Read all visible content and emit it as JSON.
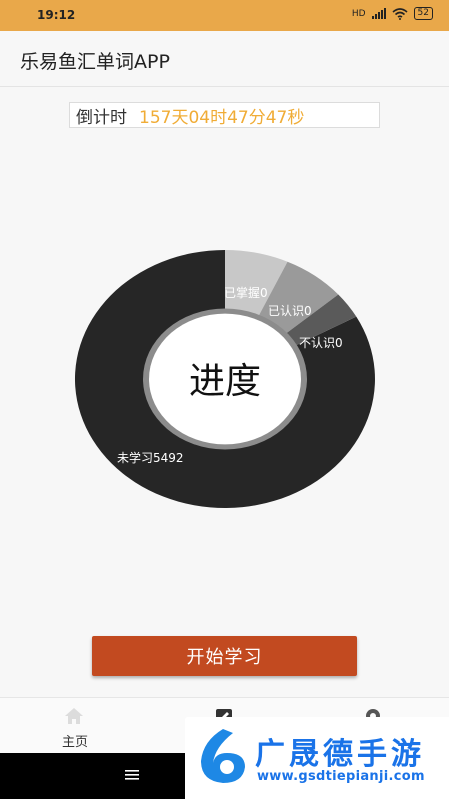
{
  "status": {
    "time": "19:12",
    "battery": "52",
    "hd_label": "HD"
  },
  "app": {
    "title": "乐易鱼汇单词APP"
  },
  "countdown": {
    "label": "倒计时",
    "value": "157天04时47分47秒"
  },
  "progress": {
    "center_label": "进度",
    "slices": [
      {
        "label": "已掌握0",
        "value": 0,
        "color": "#c8c8c8"
      },
      {
        "label": "已认识0",
        "value": 0,
        "color": "#9a9a9a"
      },
      {
        "label": "不认识0",
        "value": 0,
        "color": "#5a5a5a"
      },
      {
        "label": "未学习5492",
        "value": 5492,
        "color": "#262626"
      }
    ]
  },
  "actions": {
    "start_label": "开始学习"
  },
  "tabs": [
    {
      "label": "主页",
      "icon": "home-icon"
    },
    {
      "label": "",
      "icon": "edit-icon"
    },
    {
      "label": "",
      "icon": "gear-icon"
    }
  ],
  "watermark": {
    "text": "广晟德手游",
    "url": "www.gsdtiepianji.com"
  }
}
